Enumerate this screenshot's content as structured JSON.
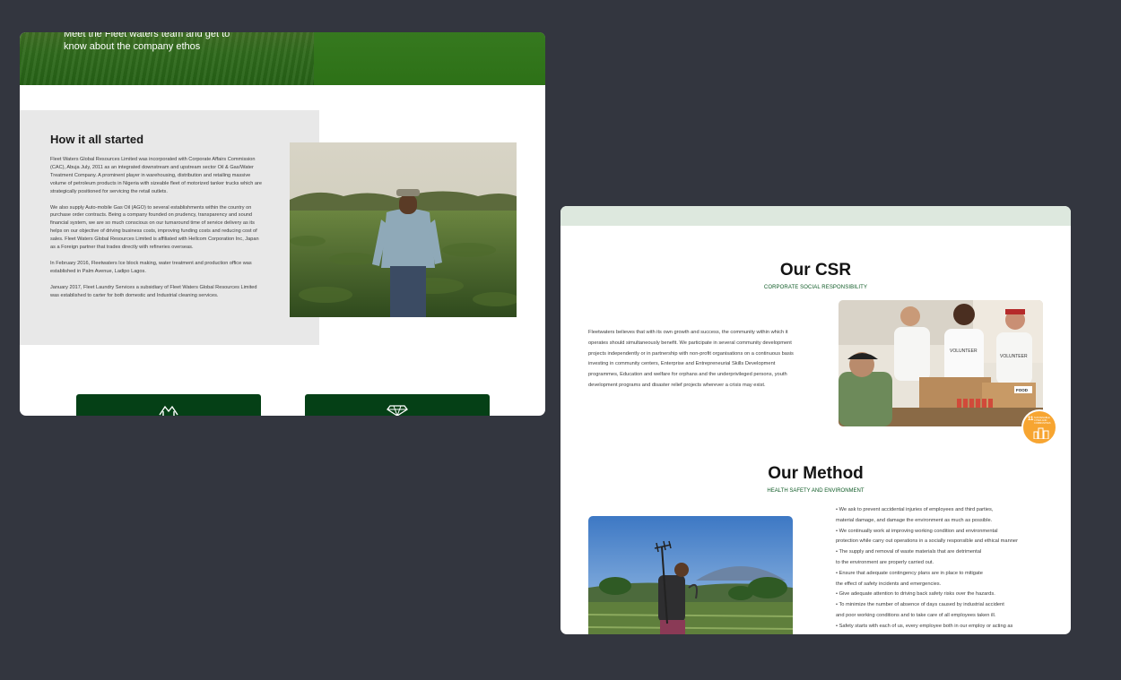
{
  "left_card": {
    "hero_text": "Meet the Fleet waters team and get to know about the company ethos",
    "section_title": "How it all started",
    "paragraphs": [
      "Fleet Waters Global Resources Limited was incorporated with Corporate Affairs Commission (CAC), Abuja July, 2011 as an integrated downstream and upstream sector Oil & Gas/Water Treatment Company. A prominent player in warehousing, distribution and retailing massive volume of petroleum products in Nigeria with sizeable fleet of motorized tanker trucks which are strategically positioned for servicing the retail outlets.",
      "We also supply Auto-mobile Gas Oil (AGO) to several establishments within the country on purchase order contracts. Being a company founded on prudency, transparency and sound financial system, we are so much conscious on our turnaround time of service delivery as its helps on our objective of driving business costs, improving funding costs and reducing cost of sales. Fleet Waters Global Resources Limited is affiliated with Hellcom Corporation Inc, Japan as a Foreign partner that trades directly with refineries overseas.",
      "In February 2016, Fleetwaters Ice block making, water treatment and production office was established in Palm Avenue, Ladipo Lagos.",
      "January 2017, Fleet Laundry Services a subsidiary of Fleet Waters Global Resources Limited was established to carter for both domestic and Industrial cleaning services."
    ],
    "feature_icons": [
      "handshake-icon",
      "diamond-icon"
    ]
  },
  "right_card": {
    "csr_title": "Our CSR",
    "csr_subtitle": "CORPORATE SOCIAL RESPONSIBILITY",
    "csr_body": "Fleetwaters believes that with its own growth and success, the community within which it operates should simultaneously benefit. We participate in several community development projects independently or in partnership with non-profit organisations on a continuous basis investing in community centers, Enterprise and Entrepreneurial Skills Development programmes, Education and welfare for orphans and the underprivileged persons, youth development programs and disaster relief projects wherever a crisis may exist.",
    "volunteer_shirt": "VOLUNTEER",
    "food_label": "FOOD",
    "sdg_number": "11",
    "sdg_caption": "SUSTAINABLE CITIES AND COMMUNITIES",
    "method_title": "Our Method",
    "method_subtitle": "HEALTH SAFETY AND ENVIRONMENT",
    "method_items": [
      "• We ask to prevent accidental injuries of employees and third parties,",
      "material damage, and damage the environment as much as possible.",
      "• We continually work at improving working condition and environmental",
      "protection while carry out operations in a socially responsible and ethical manner",
      "• The supply and removal of waste materials that are detrimental",
      "to the environment are properly carried out.",
      "• Ensure that adequate contingency plans are in place to mitigate",
      "the effect of safety incidents and emergencies.",
      "• Give adequate attention to driving back safety risks over the hazards.",
      "• To minimize the number of absence of days caused by industrial accident",
      "and poor working conditions and to take care of all employees taken ill.",
      "• Safety starts with each of us, every employee both in our employ or acting as"
    ]
  },
  "colors": {
    "background": "#33363f",
    "brand_green": "#054016",
    "accent_green": "#0e5a25",
    "band": "#dde8de",
    "sdg_orange": "#f7a531"
  }
}
